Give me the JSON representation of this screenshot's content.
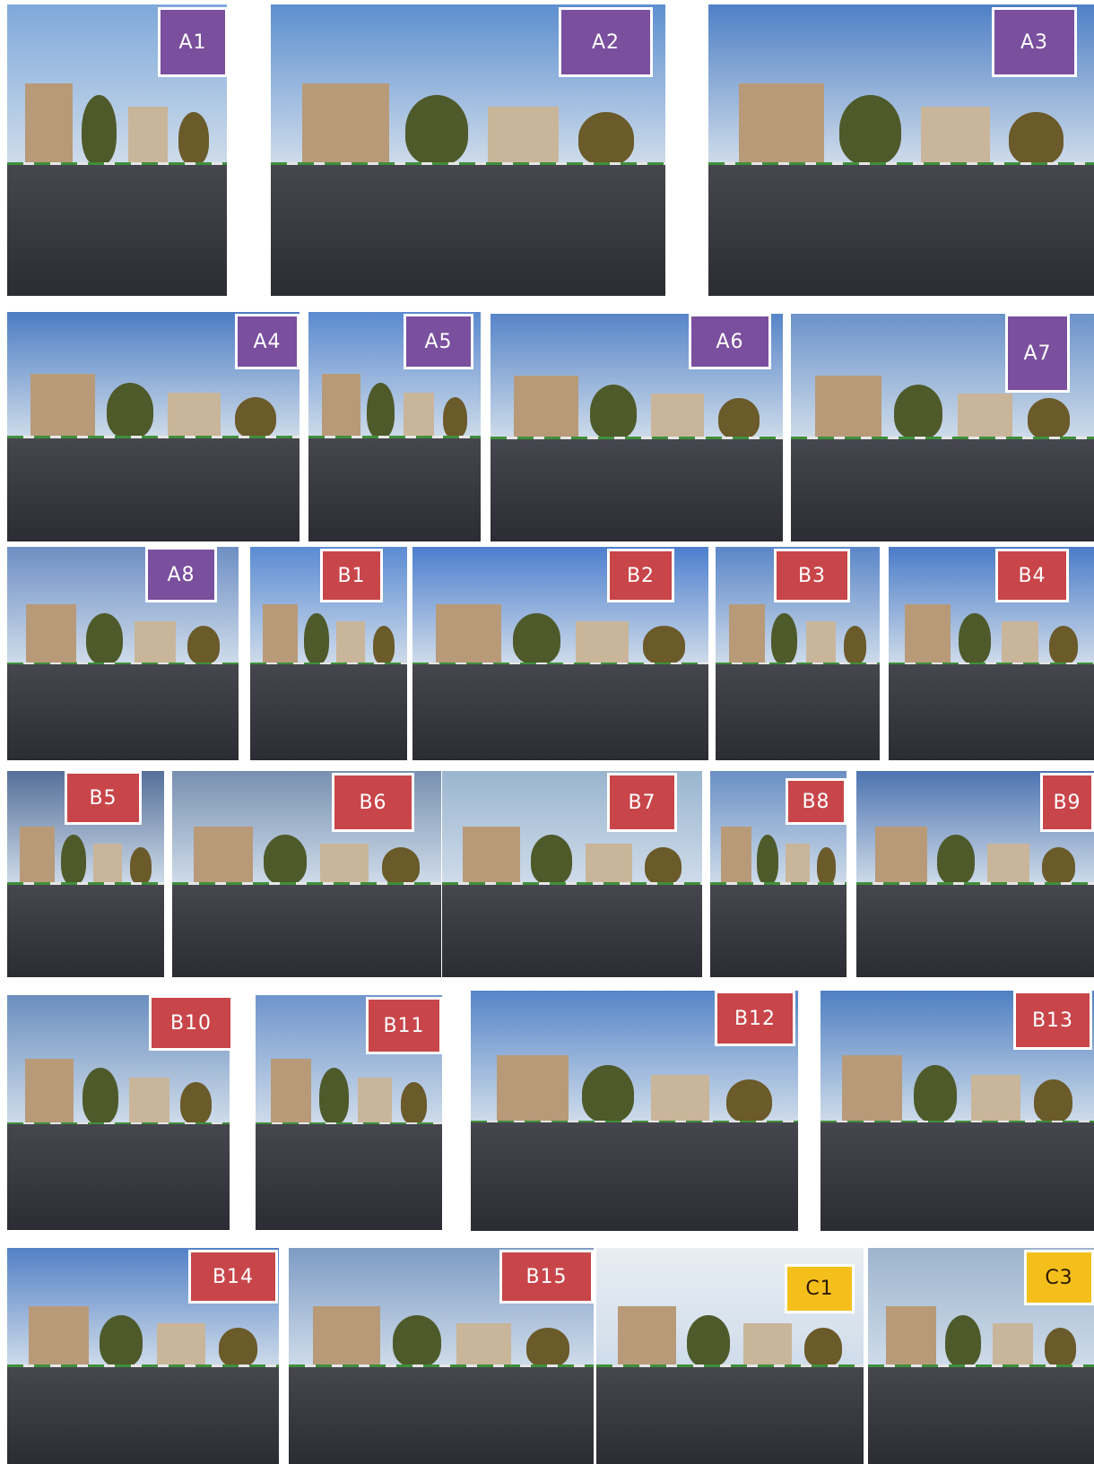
{
  "colors": {
    "label_A": "#7a4f9e",
    "label_B": "#c8454a",
    "label_C": "#f5bf1b"
  },
  "panels": [
    {
      "label": "A1",
      "group": "A",
      "sky": "#7fa9db",
      "scene": "tree-wall"
    },
    {
      "label": "A2",
      "group": "A",
      "sky": "#5d8fd0",
      "scene": "road-mountain"
    },
    {
      "label": "A3",
      "group": "A",
      "sky": "#4f80c6",
      "scene": "road-trees"
    },
    {
      "label": "A4",
      "group": "A",
      "sky": "#4d7dc4",
      "scene": "buildings-road"
    },
    {
      "label": "A5",
      "group": "A",
      "sky": "#5b8ad0",
      "scene": "road"
    },
    {
      "label": "A6",
      "group": "A",
      "sky": "#5785c8",
      "scene": "signs-trees"
    },
    {
      "label": "A7",
      "group": "A",
      "sky": "#6b93c9",
      "scene": "overpass"
    },
    {
      "label": "A8",
      "group": "A",
      "sky": "#6e8fc4",
      "scene": "signs-road"
    },
    {
      "label": "B1",
      "group": "B",
      "sky": "#5b8bd3",
      "scene": "building-car"
    },
    {
      "label": "B2",
      "group": "B",
      "sky": "#4c7fce",
      "scene": "trees-building"
    },
    {
      "label": "B3",
      "group": "B",
      "sky": "#5a86c8",
      "scene": "road-trees"
    },
    {
      "label": "B4",
      "group": "B",
      "sky": "#4b7cc8",
      "scene": "overpass"
    },
    {
      "label": "B5",
      "group": "B",
      "sky": "#56709a",
      "scene": "road-dusk"
    },
    {
      "label": "B6",
      "group": "B",
      "sky": "#7890b0",
      "scene": "road-dusk"
    },
    {
      "label": "B7",
      "group": "B",
      "sky": "#9ab5cf",
      "scene": "signs-bridge"
    },
    {
      "label": "B8",
      "group": "B",
      "sky": "#6a90c4",
      "scene": "pole-trees"
    },
    {
      "label": "B9",
      "group": "B",
      "sky": "#4d73b0",
      "scene": "buildings"
    },
    {
      "label": "B10",
      "group": "B",
      "sky": "#6b8fbf",
      "scene": "storefront"
    },
    {
      "label": "B11",
      "group": "B",
      "sky": "#6f95cc",
      "scene": "road-buildings"
    },
    {
      "label": "B12",
      "group": "B",
      "sky": "#5685c8",
      "scene": "road-buildings"
    },
    {
      "label": "B13",
      "group": "B",
      "sky": "#4f7fc2",
      "scene": "intersection"
    },
    {
      "label": "B14",
      "group": "B",
      "sky": "#5481c6",
      "scene": "shops"
    },
    {
      "label": "B15",
      "group": "B",
      "sky": "#7e9cc5",
      "scene": "buildings-road"
    },
    {
      "label": "C1",
      "group": "C",
      "sky": "#e8eef3",
      "scene": "signs-trees"
    },
    {
      "label": "C3",
      "group": "C",
      "sky": "#9db4cc",
      "scene": "road-trees"
    }
  ]
}
